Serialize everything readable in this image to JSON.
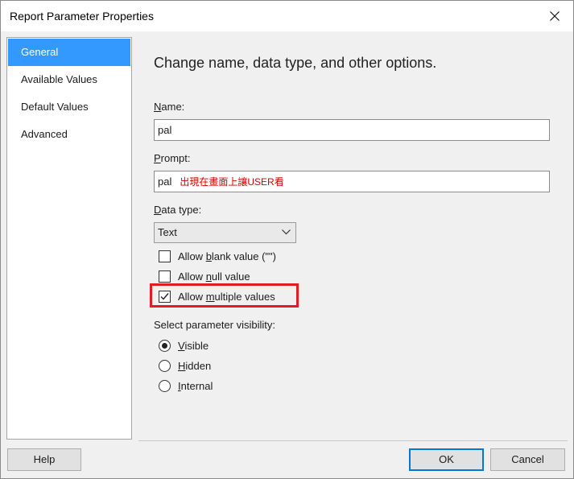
{
  "window": {
    "title": "Report Parameter Properties",
    "close_icon": "close-icon"
  },
  "nav": {
    "items": [
      {
        "label": "General",
        "selected": true
      },
      {
        "label": "Available Values",
        "selected": false
      },
      {
        "label": "Default Values",
        "selected": false
      },
      {
        "label": "Advanced",
        "selected": false
      }
    ]
  },
  "main": {
    "heading": "Change name, data type, and other options.",
    "name": {
      "label_u": "N",
      "label_rest": "ame:",
      "value": "pal"
    },
    "prompt": {
      "label_u": "P",
      "label_rest": "rompt:",
      "value": "pal",
      "note": "出現在畫面上讓USER看"
    },
    "data_type": {
      "label_u": "D",
      "label_rest": "ata type:",
      "value": "Text"
    },
    "allow_blank": {
      "pre": "Allow ",
      "u": "b",
      "post": "lank value (\"\")",
      "checked": false
    },
    "allow_null": {
      "pre": "Allow ",
      "u": "n",
      "post": "ull value",
      "checked": false
    },
    "allow_multiple": {
      "pre": "Allow ",
      "u": "m",
      "post": "ultiple values",
      "checked": true
    },
    "visibility": {
      "label": "Select parameter visibility:",
      "options": [
        {
          "u": "V",
          "rest": "isible",
          "selected": true
        },
        {
          "u": "H",
          "rest": "idden",
          "selected": false
        },
        {
          "u": "I",
          "rest": "nternal",
          "selected": false
        }
      ]
    }
  },
  "footer": {
    "help": "Help",
    "ok": "OK",
    "cancel": "Cancel"
  },
  "colors": {
    "nav_selected": "#3399ff",
    "highlight_border": "#e21b25",
    "note_text": "#d00000",
    "default_button_border": "#0078d7"
  }
}
